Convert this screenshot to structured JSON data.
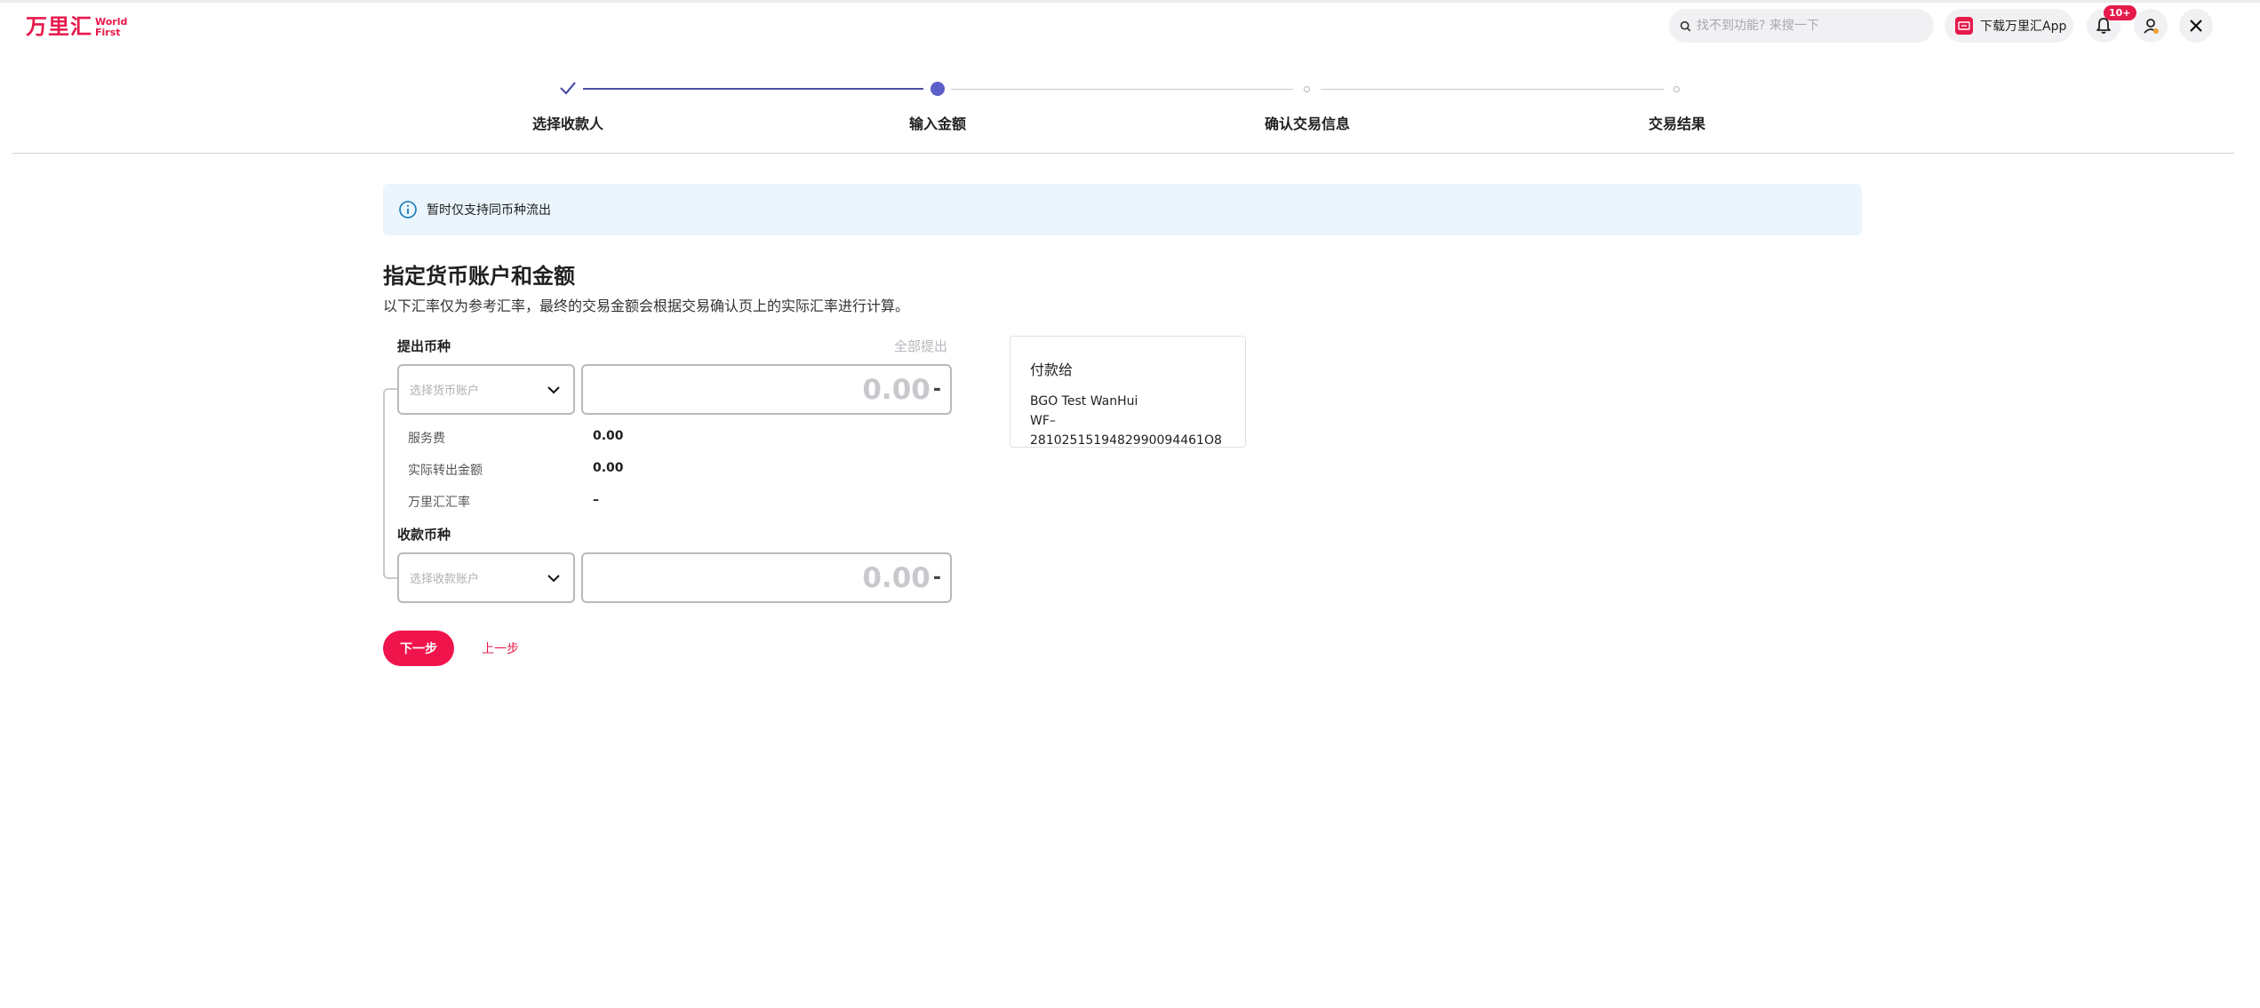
{
  "header": {
    "logo_cn": "万里汇",
    "logo_en_1": "World",
    "logo_en_2": "First",
    "search_placeholder": "找不到功能? 来搜一下",
    "download_app_label": "下载万里汇App",
    "notification_badge": "10+"
  },
  "stepper": {
    "current_step": 2,
    "steps": [
      {
        "label": "选择收款人",
        "status": "done"
      },
      {
        "label": "输入金额",
        "status": "active"
      },
      {
        "label": "确认交易信息",
        "status": "pending"
      },
      {
        "label": "交易结果",
        "status": "pending"
      }
    ]
  },
  "banner": {
    "text": "暂时仅支持同币种流出"
  },
  "form": {
    "title": "指定货币账户和金额",
    "subtitle": "以下汇率仅为参考汇率，最终的交易金额会根据交易确认页上的实际汇率进行计算。",
    "withdraw_label": "提出币种",
    "withdraw_all": "全部提出",
    "withdraw_select_placeholder": "选择货币账户",
    "withdraw_amount": "0.00",
    "withdraw_currency": "-",
    "fees": [
      {
        "label": "服务费",
        "value": "0.00"
      },
      {
        "label": "实际转出金额",
        "value": "0.00"
      },
      {
        "label": "万里汇汇率",
        "value": "–"
      }
    ],
    "receive_label": "收款币种",
    "receive_select_placeholder": "选择收款账户",
    "receive_amount": "0.00",
    "receive_currency": "-"
  },
  "payee": {
    "title": "付款给",
    "name": "BGO Test WanHui",
    "account": "WF–2810251519482990094461O8"
  },
  "actions": {
    "next_label": "下一步",
    "prev_label": "上一步"
  },
  "colors": {
    "brand": "#e6194b",
    "step_active": "#5b5fc7",
    "banner_bg": "#eaf5fd"
  }
}
